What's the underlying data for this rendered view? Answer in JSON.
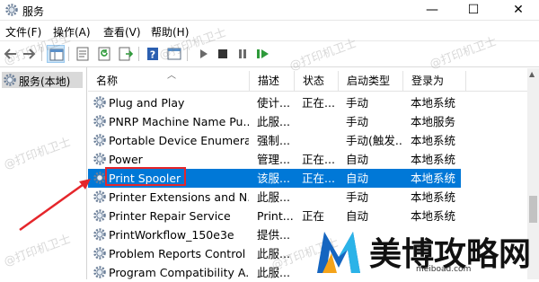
{
  "window": {
    "title": "服务",
    "min_glyph": "—",
    "max_glyph": "☐",
    "close_glyph": "✕"
  },
  "menu": [
    {
      "label": "文件(F)"
    },
    {
      "label": "操作(A)"
    },
    {
      "label": "查看(V)"
    },
    {
      "label": "帮助(H)"
    }
  ],
  "tree": {
    "root_label": "服务(本地)"
  },
  "columns": {
    "name": "名称",
    "description": "描述",
    "status": "状态",
    "startup": "启动类型",
    "logon": "登录为"
  },
  "services": [
    {
      "name": "Plug and Play",
      "description": "使计...",
      "status": "正在...",
      "startup": "手动",
      "logon": "本地系统"
    },
    {
      "name": "PNRP Machine Name Pu...",
      "description": "此服...",
      "status": "",
      "startup": "手动",
      "logon": "本地服务"
    },
    {
      "name": "Portable Device Enumera...",
      "description": "强制...",
      "status": "",
      "startup": "手动(触发...",
      "logon": "本地系统"
    },
    {
      "name": "Power",
      "description": "管理...",
      "status": "正在...",
      "startup": "自动",
      "logon": "本地系统"
    },
    {
      "name": "Print Spooler",
      "description": "该服...",
      "status": "正在...",
      "startup": "自动",
      "logon": "本地系统",
      "selected": true
    },
    {
      "name": "Printer Extensions and N...",
      "description": "此服...",
      "status": "",
      "startup": "手动",
      "logon": "本地系统"
    },
    {
      "name": "Printer Repair Service",
      "description": "Print...",
      "status": "正在",
      "startup": "自动",
      "logon": "本地系统"
    },
    {
      "name": "PrintWorkflow_150e3e",
      "description": "提供...",
      "status": "",
      "startup": "",
      "logon": ""
    },
    {
      "name": "Problem Reports Control",
      "description": "此服...",
      "status": "",
      "startup": "",
      "logon": ""
    },
    {
      "name": "Program Compatibility A...",
      "description": "此服...",
      "status": "",
      "startup": "",
      "logon": ""
    }
  ],
  "watermark": "@打印机卫士",
  "logo": {
    "text": "美博攻略网",
    "domain": "meiboad.com"
  },
  "colors": {
    "selection": "#0078d7",
    "highlight_box": "#e5262b",
    "arrow": "#e5262b"
  }
}
